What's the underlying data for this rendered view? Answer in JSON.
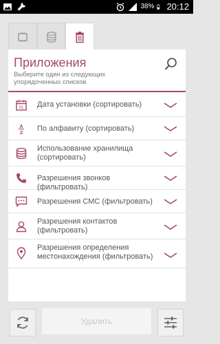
{
  "status_bar": {
    "battery": "38%",
    "time": "20:12"
  },
  "tabs": [
    {
      "icon": "cpu-icon",
      "active": false
    },
    {
      "icon": "database-icon",
      "active": false
    },
    {
      "icon": "trash-icon",
      "active": true
    }
  ],
  "header": {
    "title": "Приложения",
    "subtitle": "Выберите один из следующих упорядоченных списков"
  },
  "list": [
    {
      "icon": "calendar-icon",
      "label": "Дата установки (сортировать)"
    },
    {
      "icon": "alphabet-sort-icon",
      "label": "По алфавиту (сортировать)"
    },
    {
      "icon": "storage-icon",
      "label": "Использование хранилища (сортировать)"
    },
    {
      "icon": "phone-icon",
      "label": "Разрешения звонков (фильтровать)"
    },
    {
      "icon": "sms-icon",
      "label": "Разрешения СМС (фильтровать)"
    },
    {
      "icon": "contact-icon",
      "label": "Разрешения контактов (фильтровать)"
    },
    {
      "icon": "location-icon",
      "label": "Разрешения определения местонахождения (фильтровать)"
    }
  ],
  "actions": {
    "delete_label": "Удалить"
  },
  "colors": {
    "accent": "#a4496b",
    "background": "#e6e6e6",
    "card": "#ffffff"
  }
}
